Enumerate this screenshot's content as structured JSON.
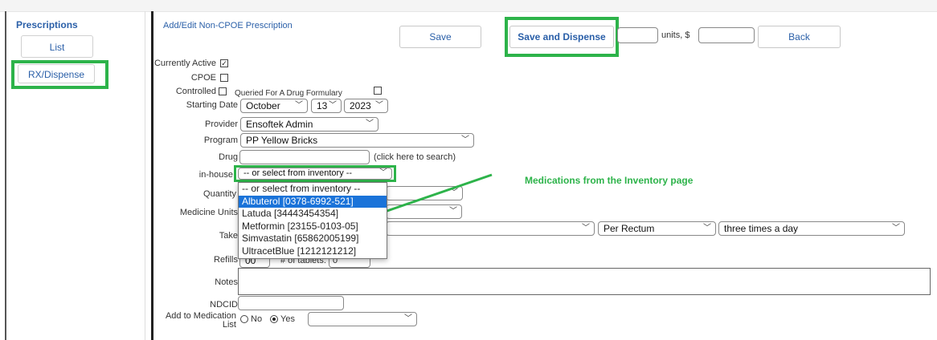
{
  "sidebar": {
    "title": "Prescriptions",
    "list_label": "List",
    "rx_label": "RX/Dispense"
  },
  "header": {
    "title": "Add/Edit Non-CPOE Prescription",
    "save_label": "Save",
    "save_dispense_label": "Save and Dispense",
    "units_label": "units, $",
    "back_label": "Back"
  },
  "form": {
    "currently_active_label": "Currently Active",
    "currently_active_checked": "✓",
    "cpoe_label": "CPOE",
    "controlled_label": "Controlled",
    "queried_label": "Queried For A Drug Formulary",
    "starting_date_label": "Starting Date",
    "month": "October",
    "day": "13",
    "year": "2023",
    "provider_label": "Provider",
    "provider_value": "Ensoftek Admin",
    "program_label": "Program",
    "program_value": "PP Yellow Bricks",
    "drug_label": "Drug",
    "drug_search_link": "(click here to search)",
    "inhouse_label": "in-house",
    "inhouse_value": "-- or select from inventory --",
    "quantity_label": "Quantity",
    "medicine_units_label": "Medicine Units",
    "take_label": "Take",
    "route_value": "Per Rectum",
    "frequency_value": "three times a day",
    "refills_label": "Refills",
    "refills_value": "00",
    "tablets_label": "# of tablets:",
    "tablets_value": "0",
    "notes_label": "Notes",
    "ndcid_label": "NDCID",
    "add_med_label_line1": "Add to Medication",
    "add_med_label_line2": "List",
    "no_label": "No",
    "yes_label": "Yes"
  },
  "inventory_options": [
    "-- or select from inventory --",
    "Albuterol [0378-6992-521]",
    "Latuda [34443454354]",
    "Metformin [23155-0103-05]",
    "Simvastatin [65862005199]",
    "UltracetBlue [1212121212]"
  ],
  "annotation": "Medications from the Inventory page",
  "colors": {
    "accent_blue": "#2a5fa8",
    "highlight_green": "#2db34a",
    "selected_option": "#1a73d9"
  }
}
